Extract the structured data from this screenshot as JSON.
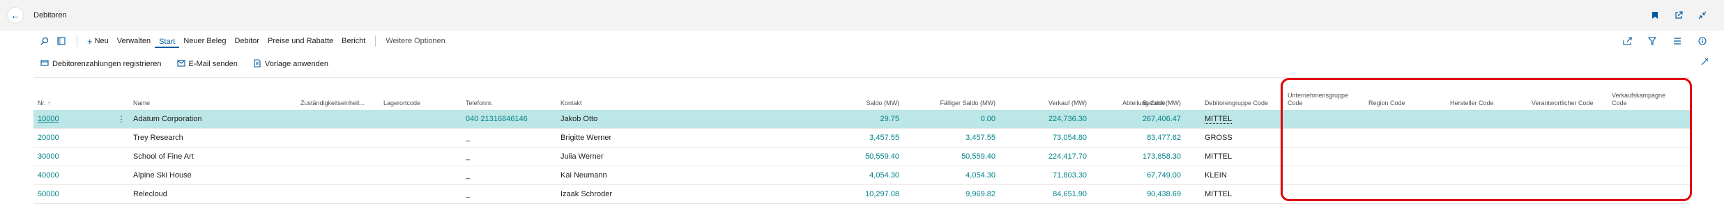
{
  "header": {
    "back_label": "←",
    "title": "Debitoren",
    "icons": [
      "bookmark-icon",
      "open-new-window-icon",
      "collapse-icon"
    ]
  },
  "actionbar": {
    "items": [
      "Neu",
      "Verwalten",
      "Start",
      "Neuer Beleg",
      "Debitor",
      "Preise und Rabatte",
      "Bericht"
    ],
    "active": "Start",
    "more": "Weitere Optionen"
  },
  "promoted": {
    "items": [
      "Debitorenzahlungen registrieren",
      "E-Mail senden",
      "Vorlage anwenden"
    ]
  },
  "table": {
    "headers": {
      "nr": "Nr. ↑",
      "name": "Name",
      "zust": "Zuständigkeitseinheit...",
      "lager": "Lagerortcode",
      "tel": "Telefonnr.",
      "kontakt": "Kontakt",
      "saldo": "Saldo (MW)",
      "faellig": "Fälliger Saldo (MW)",
      "verkauf": "Verkauf (MW)",
      "bezahlt": "Bezahlt (MW)",
      "abteilung": "Abteilung Code",
      "debgruppe": "Debitorengruppe Code",
      "untgruppe": "Unternehmensgruppe Code",
      "region": "Region Code",
      "hersteller": "Hersteller Code",
      "verantw": "Verantwortlicher Code",
      "kampagne": "Verkaufskampagne Code"
    },
    "rows": [
      {
        "nr": "10000",
        "name": "Adatum Corporation",
        "tel": "040 21316846146",
        "kontakt": "Jakob Otto",
        "saldo": "29.75",
        "faellig": "0.00",
        "verkauf": "224,736.30",
        "bezahlt": "267,406.47",
        "gruppe": "MITTEL"
      },
      {
        "nr": "20000",
        "name": "Trey Research",
        "tel": "_",
        "kontakt": "Brigitte Werner",
        "saldo": "3,457.55",
        "faellig": "3,457.55",
        "verkauf": "73,054.80",
        "bezahlt": "83,477.62",
        "gruppe": "GROSS"
      },
      {
        "nr": "30000",
        "name": "School of Fine Art",
        "tel": "_",
        "kontakt": "Julia Werner",
        "saldo": "50,559.40",
        "faellig": "50,559.40",
        "verkauf": "224,417.70",
        "bezahlt": "173,858.30",
        "gruppe": "MITTEL"
      },
      {
        "nr": "40000",
        "name": "Alpine Ski House",
        "tel": "_",
        "kontakt": "Kai Neumann",
        "saldo": "4,054.30",
        "faellig": "4,054.30",
        "verkauf": "71,803.30",
        "bezahlt": "67,749.00",
        "gruppe": "KLEIN"
      },
      {
        "nr": "50000",
        "name": "Relecloud",
        "tel": "_",
        "kontakt": "Izaak Schroder",
        "saldo": "10,297.08",
        "faellig": "9,969.82",
        "verkauf": "84,651.90",
        "bezahlt": "90,438.69",
        "gruppe": "MITTEL"
      }
    ]
  },
  "colors": {
    "accent": "#005a9e",
    "link": "#00838a",
    "selected_row": "#bde6e6",
    "highlight": "#e00000"
  }
}
